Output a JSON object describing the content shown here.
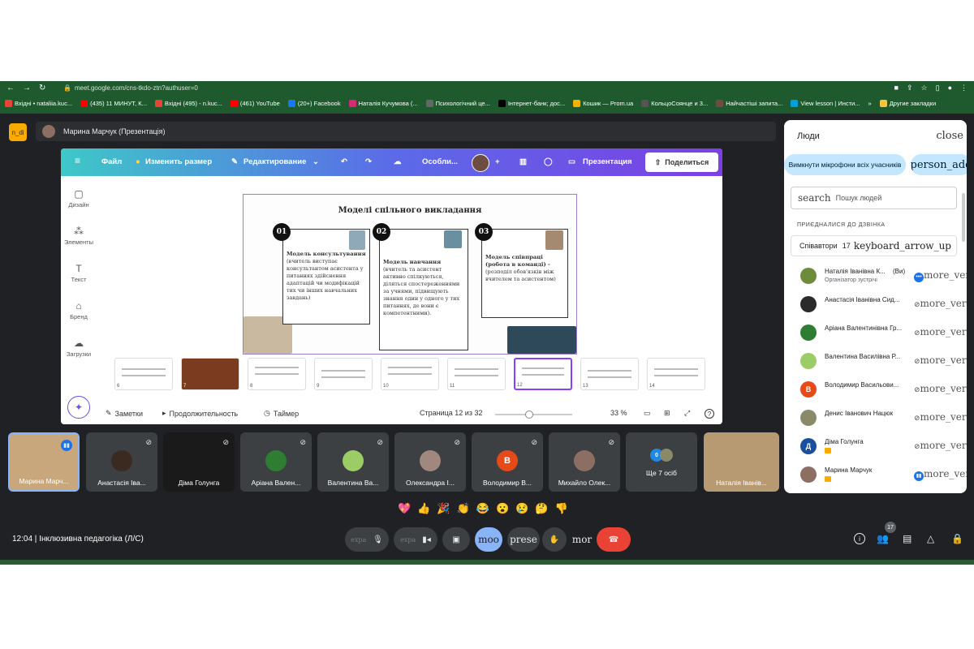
{
  "browser": {
    "url": "meet.google.com/cns-tkdo-ztn?authuser=0",
    "bookmarks": [
      {
        "label": "Вхідні • nataliia.kuc...",
        "color": "#ea4335"
      },
      {
        "label": "(435) 11 МИНУТ, К...",
        "color": "#ff0000"
      },
      {
        "label": "Вхідні (495) - n.kuc...",
        "color": "#ea4335"
      },
      {
        "label": "(461) YouTube",
        "color": "#ff0000"
      },
      {
        "label": "(20+) Facebook",
        "color": "#1877f2"
      },
      {
        "label": "Наталія Кучумова (...",
        "color": "#d62976"
      },
      {
        "label": "Психологічний це...",
        "color": "#666666"
      },
      {
        "label": "Інтернет-банк; дос...",
        "color": "#000000"
      },
      {
        "label": "Кошик — Prom.ua",
        "color": "#f4b400"
      },
      {
        "label": "КольцоСоянце и 3...",
        "color": "#555555"
      },
      {
        "label": "Найчастіші запита...",
        "color": "#6d4c41"
      },
      {
        "label": "View lesson | Инсти...",
        "color": "#00a0e0"
      }
    ],
    "more": "»",
    "other": "Другие закладки"
  },
  "meet": {
    "logo": "n_di",
    "presenter": "Марина Марчук (Презентація)",
    "canva": {
      "menu": "Файл",
      "resize": "Изменить размер",
      "edit": "Редактирование",
      "title": "Особли...",
      "presentation": "Презентация",
      "share": "Поделиться",
      "side": [
        {
          "icon": "▢",
          "label": "Дизайн"
        },
        {
          "icon": "⁂",
          "label": "Элементы"
        },
        {
          "icon": "T",
          "label": "Текст"
        },
        {
          "icon": "⌂",
          "label": "Бренд"
        },
        {
          "icon": "☁",
          "label": "Загрузки"
        }
      ],
      "slide": {
        "title": "Моделі спільного викладання",
        "cards": [
          {
            "num": "01",
            "title": "Модель консультування",
            "text": "(вчитель виступає консультантом асистента у питаннях здійснення адаптацій чи модифікацій тих чи інших навчальних завдань)"
          },
          {
            "num": "02",
            "title": "Модель навчання",
            "text": "(вчитель та асистент активно спілкуються, діляться спостереженнями за учнями, підвищують знання один у одного у тих питаннях, де вони є компетентними)."
          },
          {
            "num": "03",
            "title": "Модель співпраці (робота в команді) -",
            "text": "(розподіл обов'язків між вчителем та асистентом)"
          }
        ]
      },
      "thumbs": [
        "6",
        "7",
        "8",
        "9",
        "10",
        "11",
        "12",
        "13",
        "14"
      ],
      "notes": "Заметки",
      "duration": "Продолжительность",
      "timer": "Таймер",
      "page": "Страница 12 из 32",
      "zoom": "33 %",
      "help": "?"
    },
    "tiles": [
      {
        "name": "Марина Марч...",
        "initial": "",
        "color": "#c49a6c"
      },
      {
        "name": "Анастасія Іва...",
        "initial": "",
        "color": "#3a2a20"
      },
      {
        "name": "Діма Голунга",
        "initial": "",
        "color": "#222222"
      },
      {
        "name": "Аріана Вален...",
        "initial": "",
        "color": "#2e7d32"
      },
      {
        "name": "Валентина Ва...",
        "initial": "",
        "color": "#9ccc65"
      },
      {
        "name": "Олександра І...",
        "initial": "",
        "color": "#a1887f"
      },
      {
        "name": "Володимир В...",
        "initial": "В",
        "color": "#e64a19"
      },
      {
        "name": "Михайло Олек...",
        "initial": "",
        "color": "#8d6e63"
      },
      {
        "name": "Ще 7 осіб",
        "initial": "",
        "color": "#1e88e5"
      },
      {
        "name": "Наталія Іванів...",
        "initial": "",
        "color": "#795548"
      }
    ],
    "reactions": [
      "💖",
      "👍",
      "🎉",
      "👏",
      "😂",
      "😮",
      "😢",
      "🤔",
      "👎"
    ],
    "clock": "12:04",
    "meeting": "Інклюзивна педагогіка (Л/С)",
    "controls": {
      "exp1": "expa",
      "exp2": "expa",
      "mood": "moo",
      "present": "prese",
      "more": "mor"
    },
    "badge": "17"
  },
  "people": {
    "title": "Люди",
    "close": "close",
    "mute_all": "Вимкнути мікрофони всіх учасників",
    "person_add": "person_add",
    "search_icon": "search",
    "search_ph": "Пошук людей",
    "in_call": "ПРИЄДНАЛИСЯ ДО ДЗВІНКА",
    "collab": "Співавтори",
    "collab_count": "17",
    "collab_icon": "keyboard_arrow_up",
    "more_vert": "more_vert",
    "list": [
      {
        "name": "Наталія Іванівна К...",
        "you": "(Ви)",
        "role": "Організатор зустрічі",
        "color": "#6d8b3a",
        "initial": ""
      },
      {
        "name": "Анастасія Іванівна Сид...",
        "color": "#2b2b2b",
        "initial": ""
      },
      {
        "name": "Аріана Валентинівна Гр...",
        "color": "#2e7d32",
        "initial": ""
      },
      {
        "name": "Валентина Василівна Р...",
        "color": "#9ccc65",
        "initial": ""
      },
      {
        "name": "Володимир Васильови...",
        "color": "#e64a19",
        "initial": "В"
      },
      {
        "name": "Денис Іванович Нацюк",
        "color": "#8a8a6a",
        "initial": ""
      },
      {
        "name": "Діма Голунга",
        "color": "#1a4fa0",
        "initial": "Д"
      },
      {
        "name": "Марина Марчук",
        "color": "#8d6e63",
        "initial": ""
      }
    ]
  }
}
